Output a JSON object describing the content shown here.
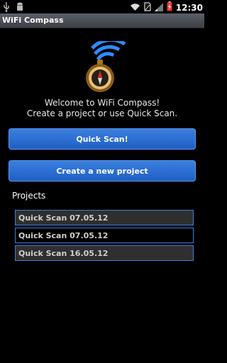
{
  "status_bar": {
    "time": "12:30",
    "icons": [
      "usb-icon",
      "android-debug-icon",
      "wifi-icon",
      "no-sim-icon",
      "signal-icon",
      "battery-icon"
    ]
  },
  "app": {
    "title": "WiFi Compass"
  },
  "welcome": {
    "line1": "Welcome to WiFi Compass!",
    "line2": "Create a project or use Quick Scan."
  },
  "buttons": {
    "quick_scan": "Quick Scan!",
    "create_project": "Create a new project"
  },
  "projects": {
    "label": "Projects",
    "items": [
      {
        "label": "Quick Scan 07.05.12"
      },
      {
        "label": "Quick Scan 07.05.12"
      },
      {
        "label": "Quick Scan 16.05.12"
      }
    ]
  },
  "colors": {
    "accent": "#2b6fd6",
    "list_border": "#3d7ed8",
    "background": "#000000"
  }
}
